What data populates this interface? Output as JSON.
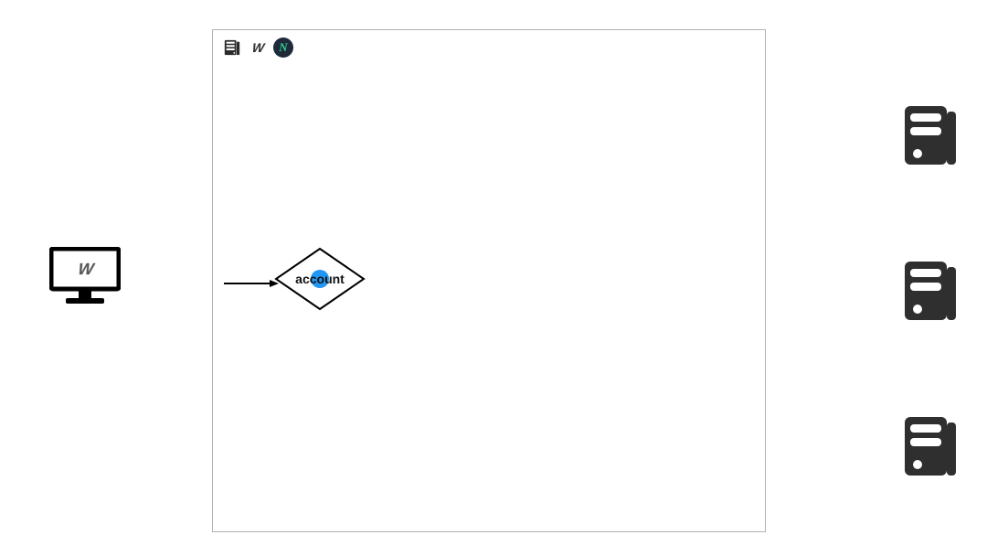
{
  "client": {
    "logo_text": "W"
  },
  "box": {
    "header_icons": {
      "server": "server-icon",
      "w_logo": "W",
      "n_badge": "N"
    }
  },
  "flow": {
    "decision_label": "account"
  },
  "servers": {
    "count": 3
  }
}
